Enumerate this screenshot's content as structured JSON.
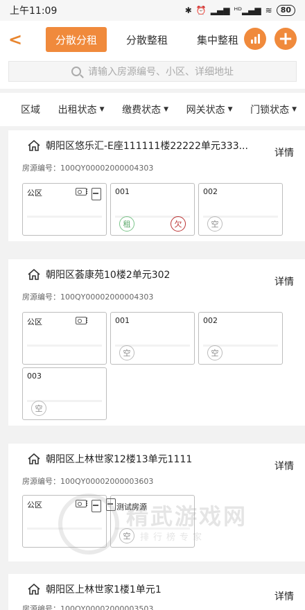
{
  "status": {
    "time": "上午11:09",
    "icons": [
      "bluetooth-icon",
      "alarm-icon",
      "signal-icon",
      "hd-signal-icon",
      "wifi-icon"
    ],
    "battery": "80"
  },
  "nav": {
    "back": "<",
    "tabs": [
      "分散分租",
      "分散整租",
      "集中整租"
    ],
    "active_tab": 0,
    "add": "+"
  },
  "search": {
    "placeholder": "请输入房源编号、小区、详细地址"
  },
  "filters": [
    "区域",
    "出租状态",
    "缴费状态",
    "网关状态",
    "门锁状态"
  ],
  "properties": [
    {
      "title": "朝阳区悠乐汇-E座111111楼22222单元333...",
      "code_label": "房源编号：",
      "code": "100QY00002000004303",
      "detail": "详情",
      "rooms": [
        {
          "name": "公区",
          "gateway": true,
          "lock": true,
          "badges": []
        },
        {
          "name": "001",
          "gateway": false,
          "lock": false,
          "badges": [
            {
              "text": "租",
              "pos": "left",
              "color": "green"
            },
            {
              "text": "欠",
              "pos": "right",
              "color": "red"
            }
          ]
        },
        {
          "name": "002",
          "gateway": false,
          "lock": false,
          "badges": [
            {
              "text": "空",
              "pos": "left",
              "color": "gray"
            }
          ]
        }
      ]
    },
    {
      "title": "朝阳区荟康苑10楼2单元302",
      "code_label": "房源编号：",
      "code": "100QY00002000004303",
      "detail": "详情",
      "rooms": [
        {
          "name": "公区",
          "gateway": true,
          "lock": false,
          "badges": []
        },
        {
          "name": "001",
          "gateway": false,
          "lock": false,
          "badges": [
            {
              "text": "空",
              "pos": "left",
              "color": "gray"
            }
          ]
        },
        {
          "name": "002",
          "gateway": false,
          "lock": false,
          "badges": [
            {
              "text": "空",
              "pos": "left",
              "color": "gray"
            }
          ]
        },
        {
          "name": "003",
          "gateway": false,
          "lock": false,
          "badges": [
            {
              "text": "空",
              "pos": "left",
              "color": "gray"
            }
          ]
        }
      ]
    },
    {
      "title": "朝阳区上林世家12楼13单元1111",
      "code_label": "房源编号：",
      "code": "100QY00002000003603",
      "detail": "详情",
      "rooms": [
        {
          "name": "公区",
          "gateway": true,
          "lock": true,
          "badges": []
        },
        {
          "name": "测试房源",
          "gateway": false,
          "lock": true,
          "badges": [
            {
              "text": "空",
              "pos": "left",
              "color": "gray"
            }
          ]
        }
      ]
    },
    {
      "title": "朝阳区上林世家1楼1单元1",
      "code_label": "房源编号：",
      "code": "100QY00002000003503",
      "detail": "详情",
      "rooms": []
    }
  ],
  "watermark": {
    "title": "精武游戏网",
    "subtitle": "排行榜专家"
  },
  "colors": {
    "accent": "#f08a3c",
    "rent_badge": "#5aa869",
    "owe_badge": "#bb3333"
  }
}
